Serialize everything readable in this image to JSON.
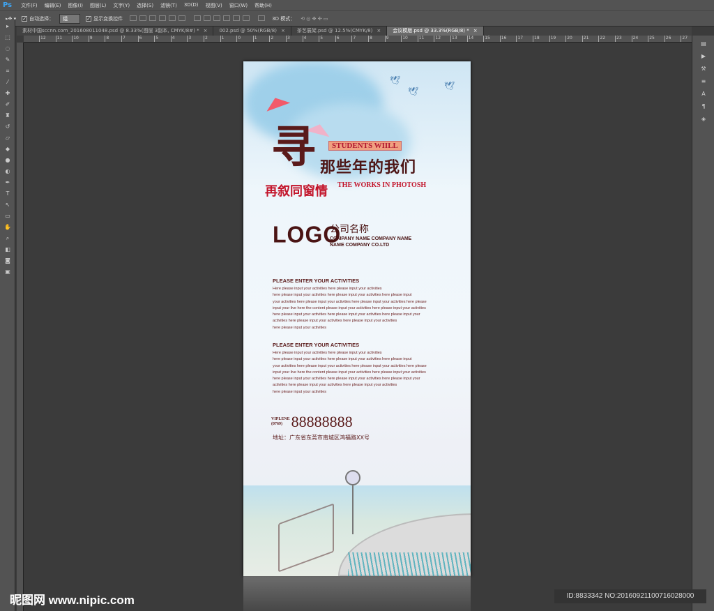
{
  "app": {
    "logo": "Ps"
  },
  "menu": [
    "文件(F)",
    "编辑(E)",
    "图像(I)",
    "图层(L)",
    "文字(Y)",
    "选择(S)",
    "滤镜(T)",
    "3D(D)",
    "视图(V)",
    "窗口(W)",
    "帮助(H)"
  ],
  "options": {
    "auto_select_label": "自动选择：",
    "auto_select_value": "组",
    "show_transform_label": "显示变换控件",
    "mode_3d_label": "3D 模式："
  },
  "tabs": [
    {
      "label": "素材中国sccnn.com_201608011048.psd @ 8.33%(图层 3副本, CMYK/8#) *",
      "active": false
    },
    {
      "label": "002.psd @ 50%(RGB/8)",
      "active": false
    },
    {
      "label": "茶艺展架.psd @ 12.5%(CMYK/8)",
      "active": false
    },
    {
      "label": "会议模版.psd @ 33.3%(RGB/8) *",
      "active": true
    }
  ],
  "ruler_labels": [
    "12",
    "11",
    "10",
    "9",
    "8",
    "7",
    "6",
    "5",
    "4",
    "3",
    "2",
    "1",
    "0",
    "1",
    "2",
    "3",
    "4",
    "5",
    "6",
    "7",
    "8",
    "9",
    "10",
    "11",
    "12",
    "13",
    "14",
    "15",
    "16",
    "17",
    "18",
    "19",
    "20",
    "21",
    "22",
    "23",
    "24",
    "25",
    "26",
    "27"
  ],
  "poster": {
    "big_char": "寻",
    "students": "STUDENTS WIILL",
    "headline_cn": "那些年的我们",
    "subline_cn": "再叙同窗情",
    "works": "THE WORKS IN PHOTOSH",
    "logo": "LOGO",
    "company_cn": "公司名称",
    "company_en1": "COMPANY NAME COMPANY NAME",
    "company_en2": "NAME COMPANY CO.LTD",
    "blocks": [
      {
        "title": "PLEASE ENTER YOUR ACTIVITIES",
        "lines": [
          "Here please input your activities here please input your activities",
          "here please input your activities here please input your activities here please input",
          "your activities here please input your activities here please input your activities here please",
          "input your live here the content please input your activities here please input your activities",
          "here please input your activities here please input your activities here please input your",
          " activities here please input your activities here please input your activities",
          "here please input your activities"
        ]
      },
      {
        "title": "PLEASE ENTER YOUR ACTIVITIES",
        "lines": [
          "Here please input your activities here please input your activities",
          "here please input your activities here please input your activities here please input",
          "your activities here please input your activities here please input your activities here please",
          "input your live here the content please input your activities here please input your activities",
          "here please input your activities here please input your activities here please input your",
          " activities here please input your activities here please input your activities",
          "here please input your activities"
        ]
      }
    ],
    "phone_label1": "VIPLENE",
    "phone_label2": "(0769)",
    "phone": "88888888",
    "address": "地址：广东省东莞市南城区鸿福路XX号"
  },
  "watermark": "昵图网 www.nipic.com",
  "image_id": "ID:8833342 NO:20160921100716028000"
}
